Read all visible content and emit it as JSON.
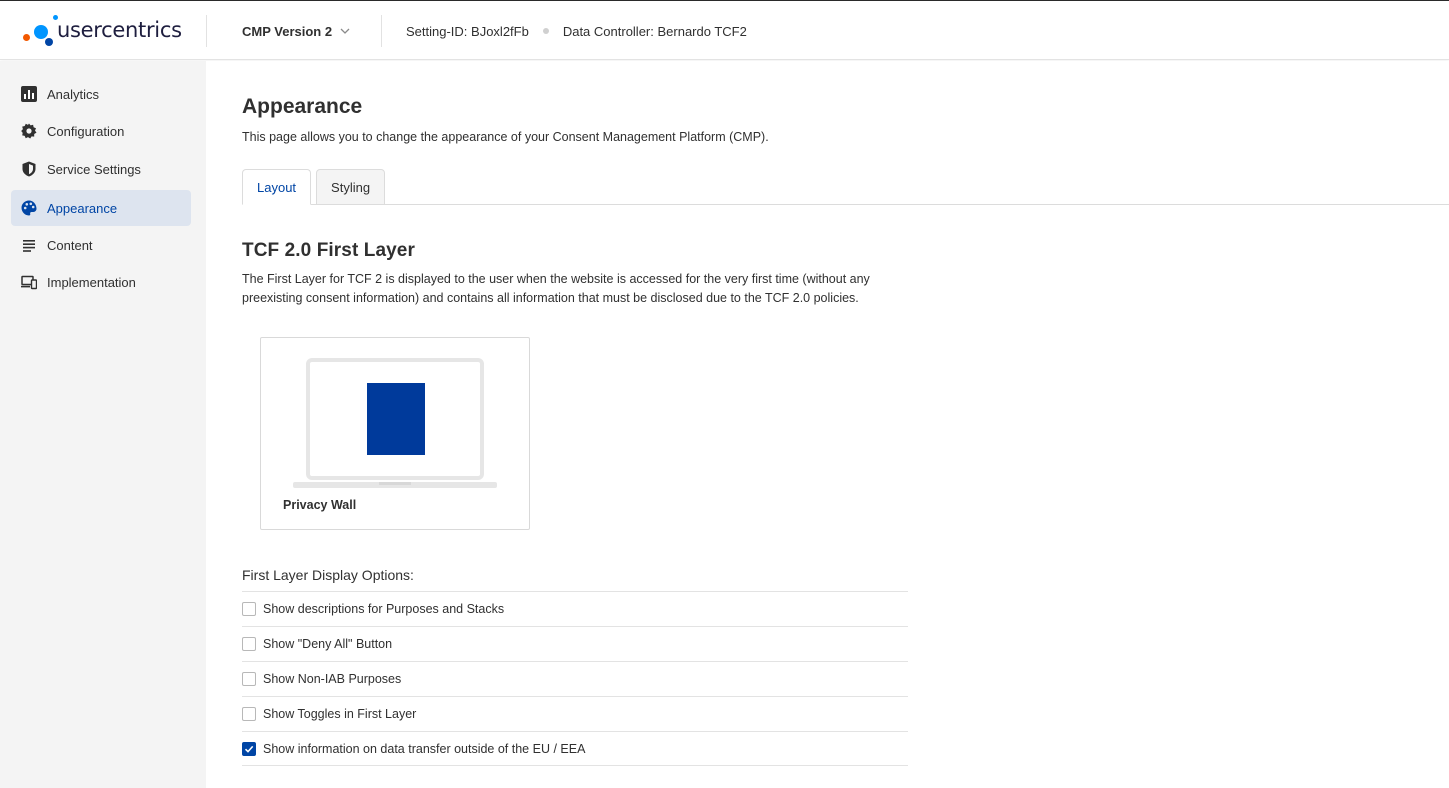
{
  "header": {
    "brand": "usercentrics",
    "cmp_version": "CMP Version 2",
    "setting_id": "Setting-ID: BJoxl2fFb",
    "data_controller": "Data Controller: Bernardo TCF2"
  },
  "sidebar": {
    "items": [
      {
        "label": "Analytics",
        "icon": "bar-chart-icon",
        "active": false
      },
      {
        "label": "Configuration",
        "icon": "gear-icon",
        "active": false
      },
      {
        "label": "Service Settings",
        "icon": "shield-icon",
        "active": false
      },
      {
        "label": "Appearance",
        "icon": "palette-icon",
        "active": true
      },
      {
        "label": "Content",
        "icon": "lines-icon",
        "active": false
      },
      {
        "label": "Implementation",
        "icon": "devices-icon",
        "active": false
      }
    ]
  },
  "main": {
    "title": "Appearance",
    "description": "This page allows you to change the appearance of your Consent Management Platform (CMP).",
    "tabs": [
      {
        "label": "Layout",
        "active": true
      },
      {
        "label": "Styling",
        "active": false
      }
    ],
    "section": {
      "title": "TCF 2.0 First Layer",
      "description": "The First Layer for TCF 2 is displayed to the user when the website is accessed for the very first time (without any preexisting consent information) and contains all information that must be disclosed due to the TCF 2.0 policies.",
      "layout_card": {
        "label": "Privacy Wall"
      }
    },
    "options": {
      "title": "First Layer Display Options:",
      "items": [
        {
          "label": "Show descriptions for Purposes and Stacks",
          "checked": false
        },
        {
          "label": "Show \"Deny All\" Button",
          "checked": false
        },
        {
          "label": "Show Non-IAB Purposes",
          "checked": false
        },
        {
          "label": "Show Toggles in First Layer",
          "checked": false
        },
        {
          "label": "Show information on data transfer outside of the EU / EEA",
          "checked": true
        }
      ]
    }
  },
  "colors": {
    "accent": "#0045a5",
    "active_nav_bg": "#dde4ef",
    "sidebar_bg": "#f4f4f4"
  }
}
